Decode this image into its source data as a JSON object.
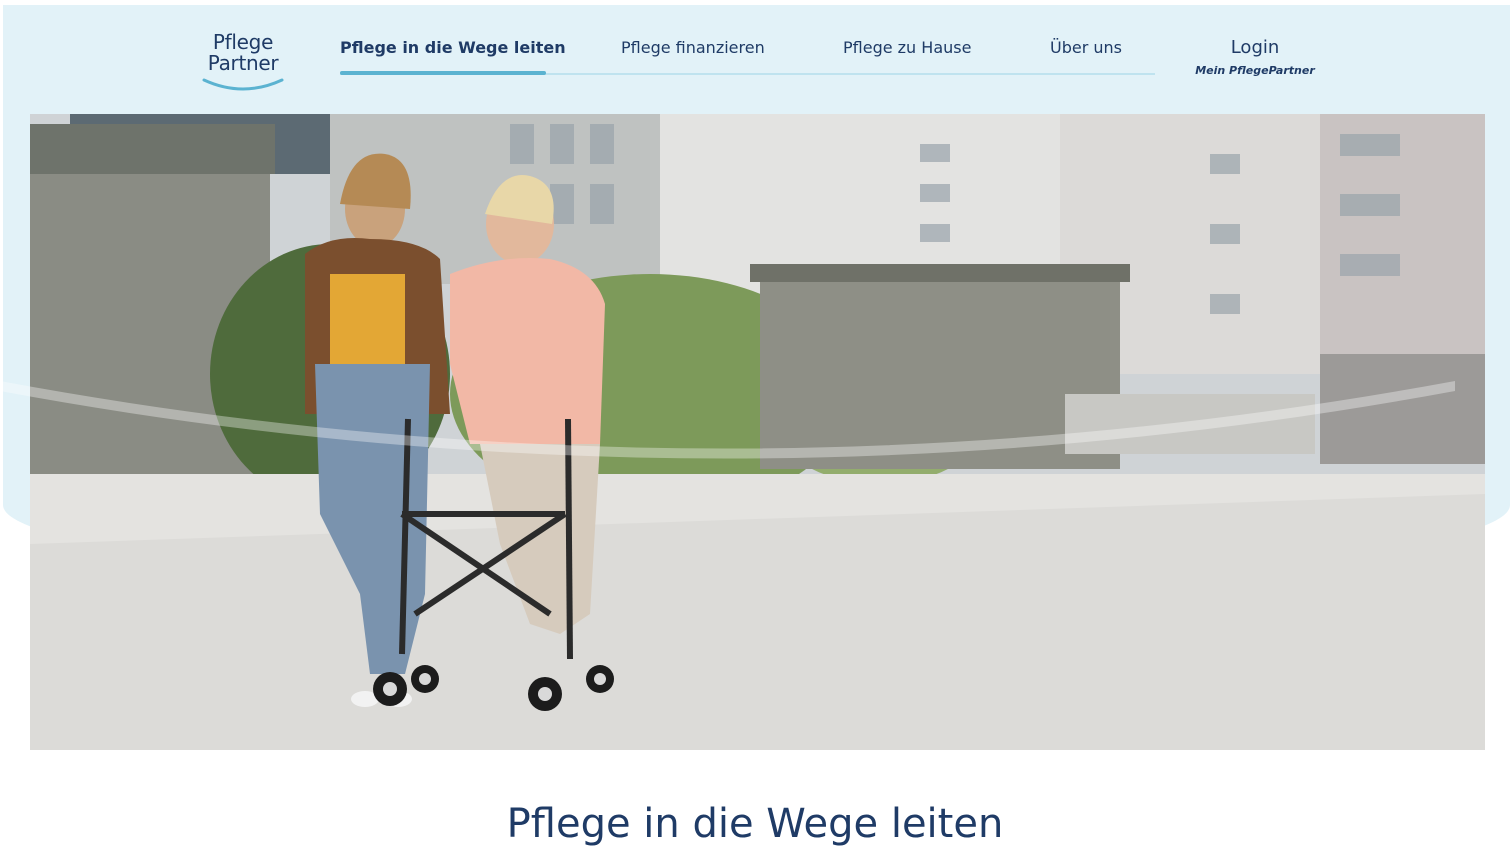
{
  "logo": {
    "line1": "Pflege",
    "line2": "Partner"
  },
  "nav": {
    "items": [
      {
        "label": "Pflege in die Wege leiten",
        "active": true
      },
      {
        "label": "Pflege finanzieren",
        "active": false
      },
      {
        "label": "Pflege zu Hause",
        "active": false
      },
      {
        "label": "Über uns",
        "active": false
      }
    ]
  },
  "login": {
    "label": "Login",
    "sublabel": "Mein PflegePartner"
  },
  "main": {
    "title": "Pflege in die Wege leiten"
  },
  "colors": {
    "brand_navy": "#1f3b66",
    "accent_blue": "#5bb3d1",
    "header_bg": "#e2f2f8"
  }
}
